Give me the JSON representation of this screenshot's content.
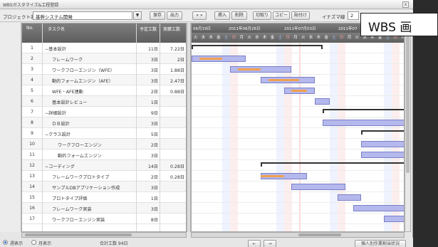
{
  "window": {
    "title": "WBSガスタマイズ&工程登録",
    "close_label": "x"
  },
  "toolbar": {
    "project_label": "プロジェクト名:",
    "project_value": "基幹システム開発",
    "save": "保存",
    "output": "出力",
    "nav": "« »",
    "insert": "挿入",
    "delete": "削除",
    "cut": "切取り",
    "copy": "コピー",
    "paste": "貼付け",
    "inazuma_label": "イナズマ線",
    "inazuma_value": "2"
  },
  "callout": {
    "text": "WBS 画"
  },
  "columns": {
    "no": "No.",
    "task": "タスク名",
    "plan": "予定工数",
    "actual": "実績工数"
  },
  "gantt": {
    "weeks": [
      "06月19日",
      "2011年06月26日",
      "2011年07月03日",
      "2011年07"
    ],
    "days": [
      "火",
      "水",
      "木",
      "金",
      "土",
      "日",
      "月",
      "火",
      "水",
      "木",
      "金",
      "土",
      "日",
      "月",
      "火",
      "水",
      "木",
      "金",
      "土",
      "日",
      "月",
      "火",
      "水",
      "木",
      "金",
      "土",
      "日",
      "月"
    ]
  },
  "tasks": [
    {
      "no": "1",
      "name": "−基本設計",
      "plan": "11日",
      "actual": "7.22日"
    },
    {
      "no": "2",
      "name": "フレームワーク",
      "plan": "3日",
      "actual": "2日"
    },
    {
      "no": "3",
      "name": "ワークフローエンジン（WFE）",
      "plan": "3日",
      "actual": "1.88日"
    },
    {
      "no": "4",
      "name": "動的フォームエンジン（AFE）",
      "plan": "3日",
      "actual": "2.47日"
    },
    {
      "no": "5",
      "name": "WFE・AFE連動",
      "plan": "2日",
      "actual": "0.88日"
    },
    {
      "no": "6",
      "name": "基本設計レビュー",
      "plan": "1日",
      "actual": ""
    },
    {
      "no": "7",
      "name": "−詳細設計",
      "plan": "9日",
      "actual": ""
    },
    {
      "no": "8",
      "name": "ＤＢ設計",
      "plan": "3日",
      "actual": ""
    },
    {
      "no": "9",
      "name": "−クラス設計",
      "plan": "5日",
      "actual": ""
    },
    {
      "no": "10",
      "name": "ワークフローエンジン",
      "plan": "2日",
      "actual": ""
    },
    {
      "no": "11",
      "name": "動的フォームエンジン",
      "plan": "3日",
      "actual": ""
    },
    {
      "no": "12",
      "name": "−コーディング",
      "plan": "14日",
      "actual": "0.28日"
    },
    {
      "no": "13",
      "name": "フレームワークプロトタイプ",
      "plan": "2日",
      "actual": "0.28日"
    },
    {
      "no": "14",
      "name": "サンプルDBアプリケーション作成",
      "plan": "3日",
      "actual": ""
    },
    {
      "no": "15",
      "name": "プロトタイプ評価",
      "plan": "1日",
      "actual": ""
    },
    {
      "no": "16",
      "name": "フレームワーク実装",
      "plan": "3日",
      "actual": ""
    },
    {
      "no": "17",
      "name": "ワークフローエンジン実装",
      "plan": "8日",
      "actual": ""
    }
  ],
  "chart_data": {
    "type": "gantt",
    "unit": "days",
    "start_day_label": "06月19日",
    "rows": [
      {
        "row": 1,
        "kind": "summary",
        "start": 1,
        "end": 17
      },
      {
        "row": 2,
        "kind": "task",
        "plan_start": 1,
        "plan_end": 7,
        "act_start": 2,
        "act_end": 4
      },
      {
        "row": 3,
        "kind": "task",
        "plan_start": 6,
        "plan_end": 13,
        "act_start": 7,
        "act_end": 9
      },
      {
        "row": 4,
        "kind": "task",
        "plan_start": 10,
        "plan_end": 16,
        "act_start": 11,
        "act_end": 14
      },
      {
        "row": 5,
        "kind": "task",
        "plan_start": 13,
        "plan_end": 16,
        "act_start": 14,
        "act_end": 15
      },
      {
        "row": 6,
        "kind": "task",
        "plan_start": 17,
        "plan_end": 18
      },
      {
        "row": 7,
        "kind": "summary",
        "start": 18,
        "end": 28
      },
      {
        "row": 8,
        "kind": "task",
        "plan_start": 18,
        "plan_end": 28
      },
      {
        "row": 9,
        "kind": "summary",
        "start": 23,
        "end": 28
      },
      {
        "row": 10,
        "kind": "task",
        "plan_start": 23,
        "plan_end": 28
      },
      {
        "row": 11,
        "kind": "task",
        "plan_start": 23,
        "plan_end": 28
      },
      {
        "row": 12,
        "kind": "summary",
        "start": 10,
        "end": 28
      },
      {
        "row": 13,
        "kind": "task",
        "plan_start": 10,
        "plan_end": 15,
        "act_start": 10,
        "act_end": 12
      },
      {
        "row": 14,
        "kind": "task",
        "plan_start": 14,
        "plan_end": 20
      },
      {
        "row": 15,
        "kind": "task",
        "plan_start": 20,
        "plan_end": 22
      },
      {
        "row": 16,
        "kind": "task",
        "plan_start": 22,
        "plan_end": 28
      },
      {
        "row": 17,
        "kind": "task",
        "plan_start": 26,
        "plan_end": 28
      }
    ]
  },
  "status": {
    "radio1": "週表示",
    "radio2": "月表示",
    "total": "合計工数 94日",
    "nav_prev": "←",
    "nav_next": "→",
    "report_button": "個人別作業割当状況"
  }
}
